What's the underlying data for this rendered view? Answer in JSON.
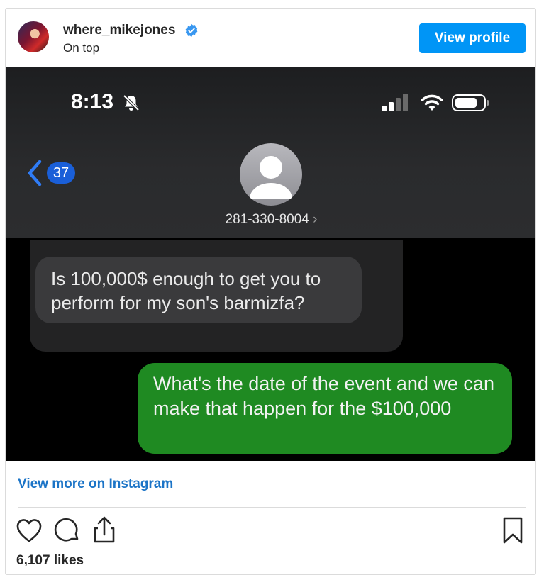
{
  "post": {
    "username": "where_mikejones",
    "subtitle": "On top",
    "view_profile_label": "View profile",
    "verified": true
  },
  "screenshot": {
    "status_time": "8:13",
    "back_badge_count": "37",
    "contact_number": "281-330-8004",
    "contact_chevron": "›",
    "messages": [
      {
        "direction": "received",
        "text": "Is 100,000$ enough to get you to perform for my son's barmizfa?"
      },
      {
        "direction": "sent",
        "text": "What's the date of the event and we can make that happen for the $100,000"
      }
    ]
  },
  "footer": {
    "view_more_label": "View more on Instagram",
    "likes": "6,107 likes"
  },
  "colors": {
    "accent": "#0095f6",
    "link": "#1b74c7",
    "sent_bubble": "#1f8a22",
    "received_bubble": "#3a3a3c"
  },
  "icons": [
    "verified-badge-icon",
    "bell-slash-icon",
    "signal-icon",
    "wifi-icon",
    "battery-icon",
    "back-chevron-icon",
    "contact-avatar-icon",
    "heart-icon",
    "comment-icon",
    "share-icon",
    "bookmark-icon"
  ]
}
